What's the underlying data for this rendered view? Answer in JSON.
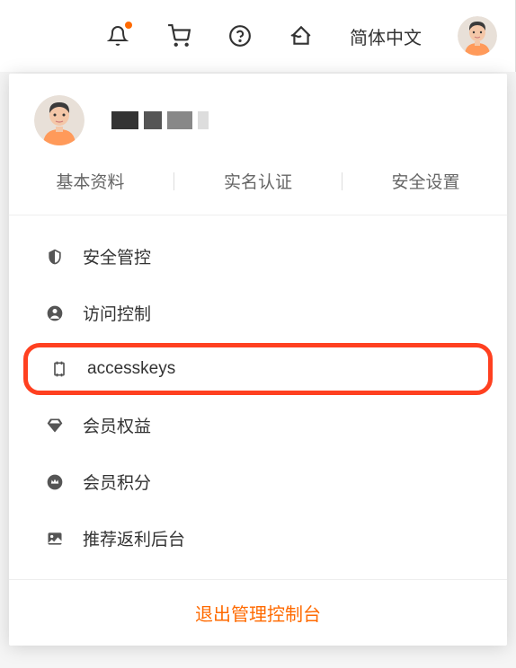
{
  "topbar": {
    "language": "简体中文"
  },
  "user": {
    "name": ""
  },
  "tabs": {
    "profile": "基本资料",
    "verify": "实名认证",
    "security": "安全设置"
  },
  "menu": {
    "security_control": "安全管控",
    "access_control": "访问控制",
    "accesskeys": "accesskeys",
    "member_benefits": "会员权益",
    "member_points": "会员积分",
    "referral": "推荐返利后台"
  },
  "logout": "退出管理控制台"
}
